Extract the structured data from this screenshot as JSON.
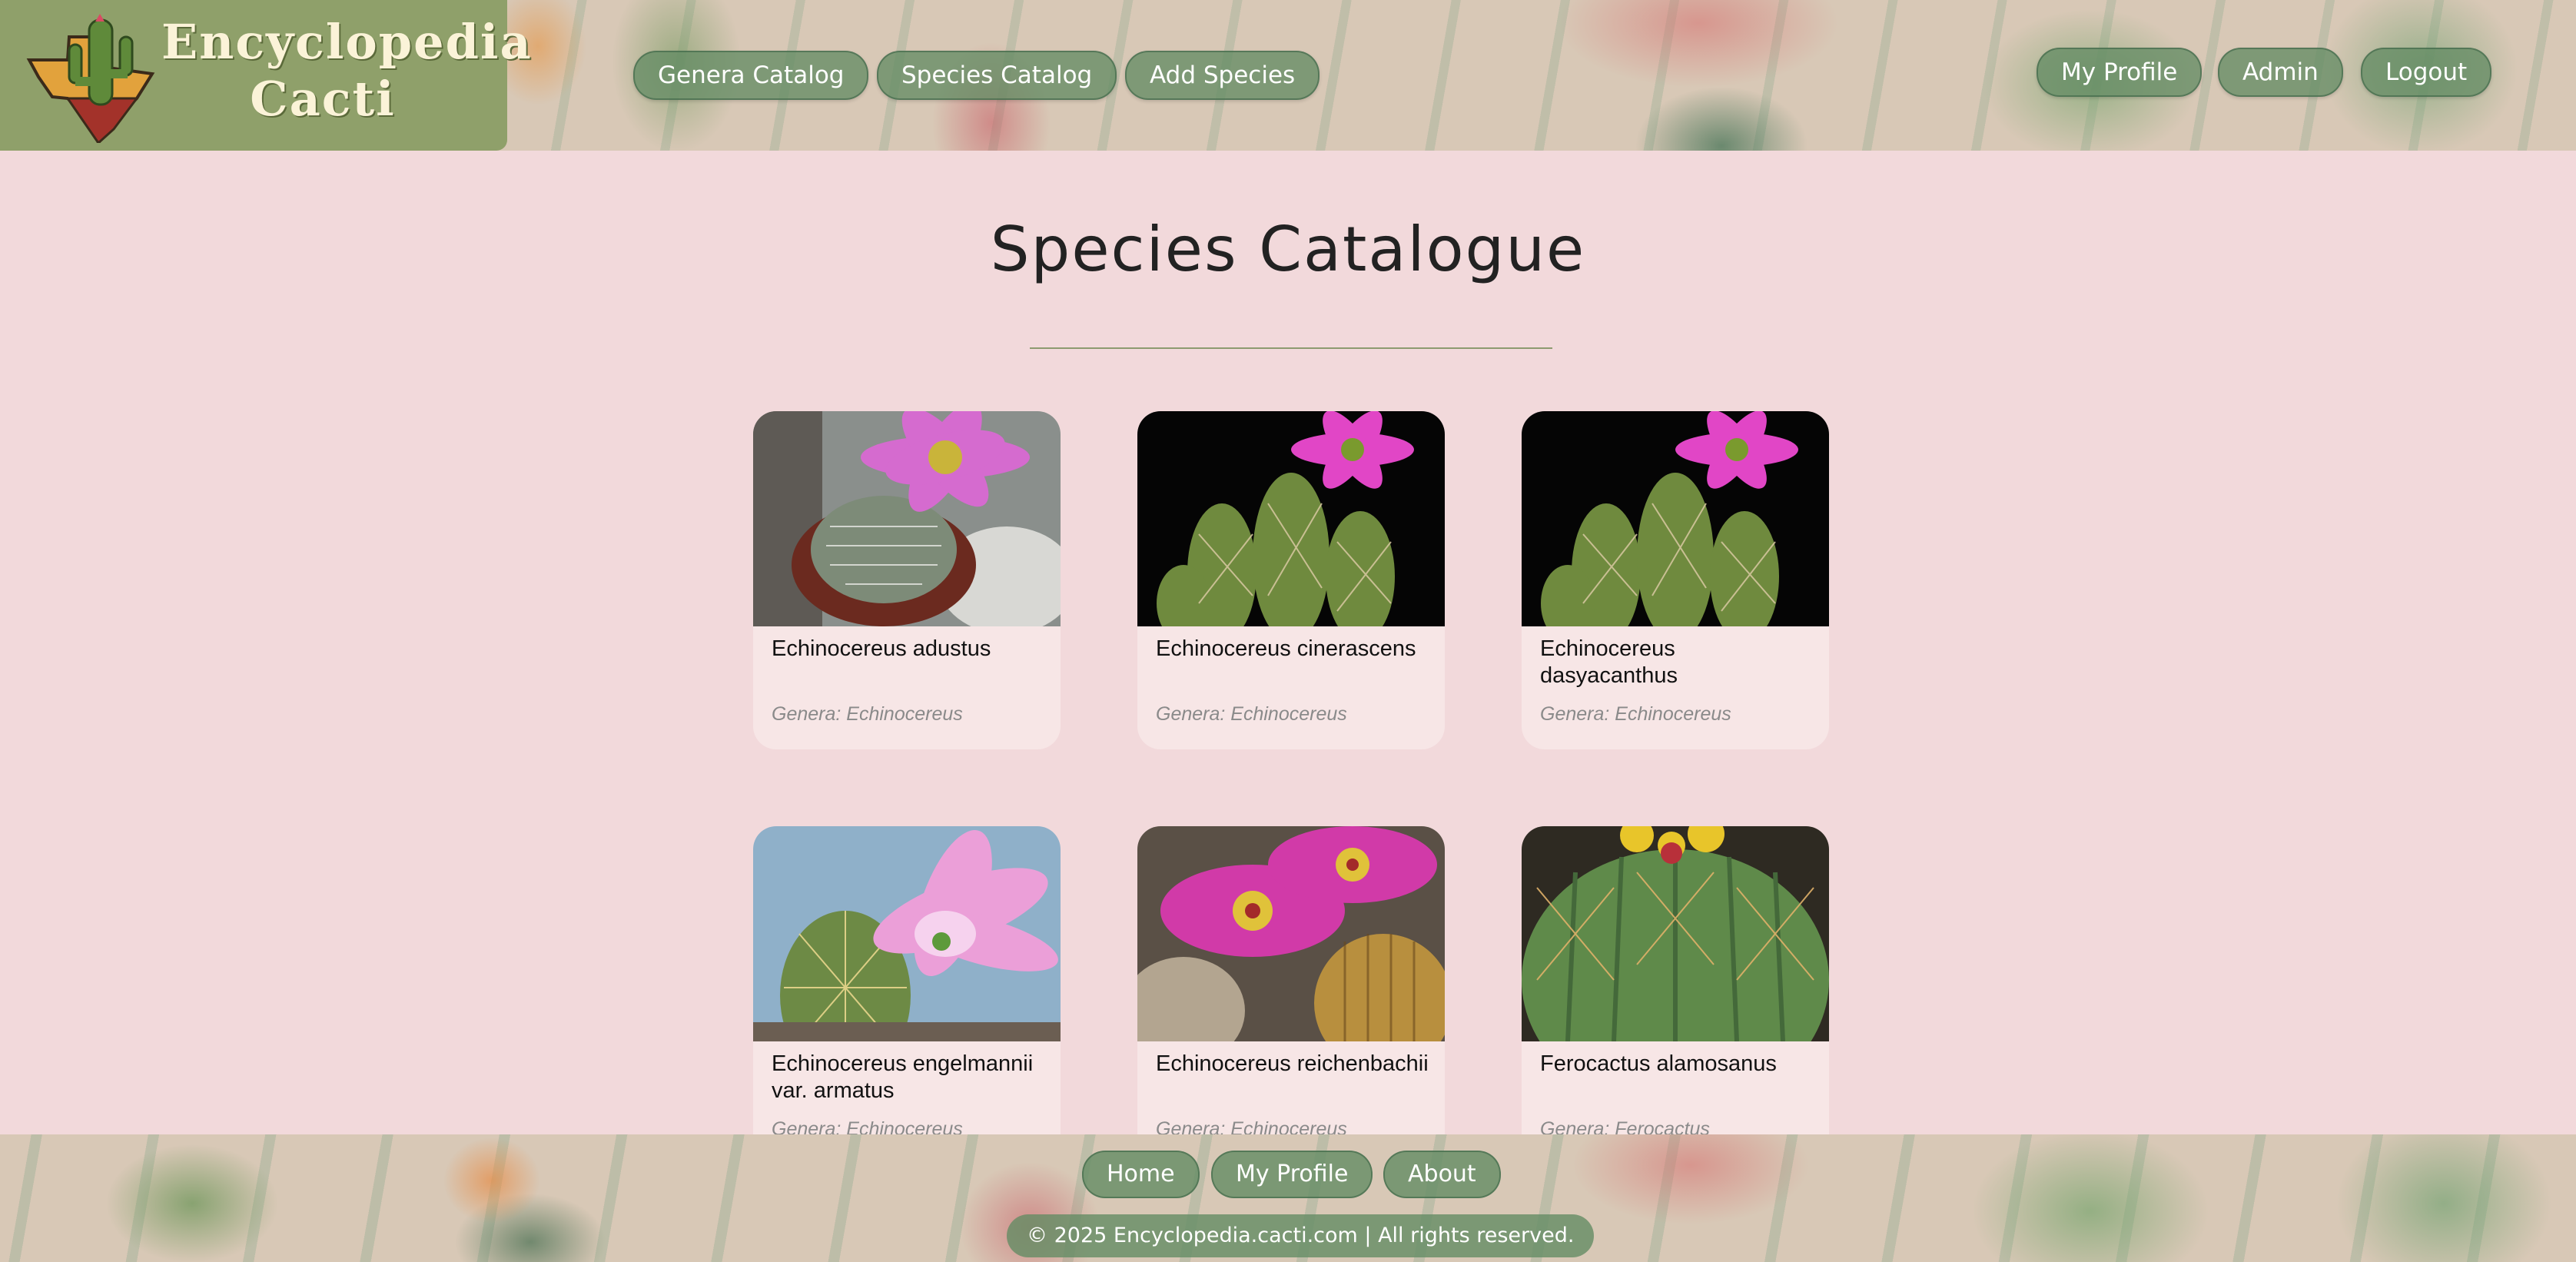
{
  "brand": {
    "line1": "Encyclopedia",
    "line2": "Cacti",
    "logo_icon": "cactus-texas-logo-icon"
  },
  "nav": {
    "left": [
      {
        "label": "Genera Catalog"
      },
      {
        "label": "Species Catalog"
      },
      {
        "label": "Add Species"
      }
    ],
    "right": [
      {
        "label": "My Profile"
      },
      {
        "label": "Admin"
      },
      {
        "label": "Logout"
      }
    ]
  },
  "main": {
    "title": "Species Catalogue",
    "species": [
      {
        "name": "Echinocereus adustus",
        "genus": "Genera: Echinocereus",
        "photo": "cactus-photo-pink-flower-pot"
      },
      {
        "name": "Echinocereus cinerascens",
        "genus": "Genera: Echinocereus",
        "photo": "cactus-photo-magenta-flower-black-bg"
      },
      {
        "name": "Echinocereus dasyacanthus",
        "genus": "Genera: Echinocereus",
        "photo": "cactus-photo-magenta-flower-black-bg"
      },
      {
        "name": "Echinocereus engelmannii var. armatus",
        "genus": "Genera: Echinocereus",
        "photo": "cactus-photo-pink-flower-blue-sky"
      },
      {
        "name": "Echinocereus reichenbachii",
        "genus": "Genera: Echinocereus",
        "photo": "cactus-photo-magenta-flowers-cluster"
      },
      {
        "name": "Ferocactus alamosanus",
        "genus": "Genera: Ferocactus",
        "photo": "cactus-photo-barrel-yellow-flowers"
      }
    ]
  },
  "footer": {
    "links": [
      {
        "label": "Home"
      },
      {
        "label": "My Profile"
      },
      {
        "label": "About"
      }
    ],
    "copyright": "© 2025 Encyclopedia.cacti.com | All rights reserved."
  },
  "colors": {
    "page_bg": "#f2d9db",
    "card_bg": "#f7e6e6",
    "logo_bg": "#8fa06a",
    "button_bg": "#6f9070",
    "genus_text": "#8a8a8a"
  }
}
